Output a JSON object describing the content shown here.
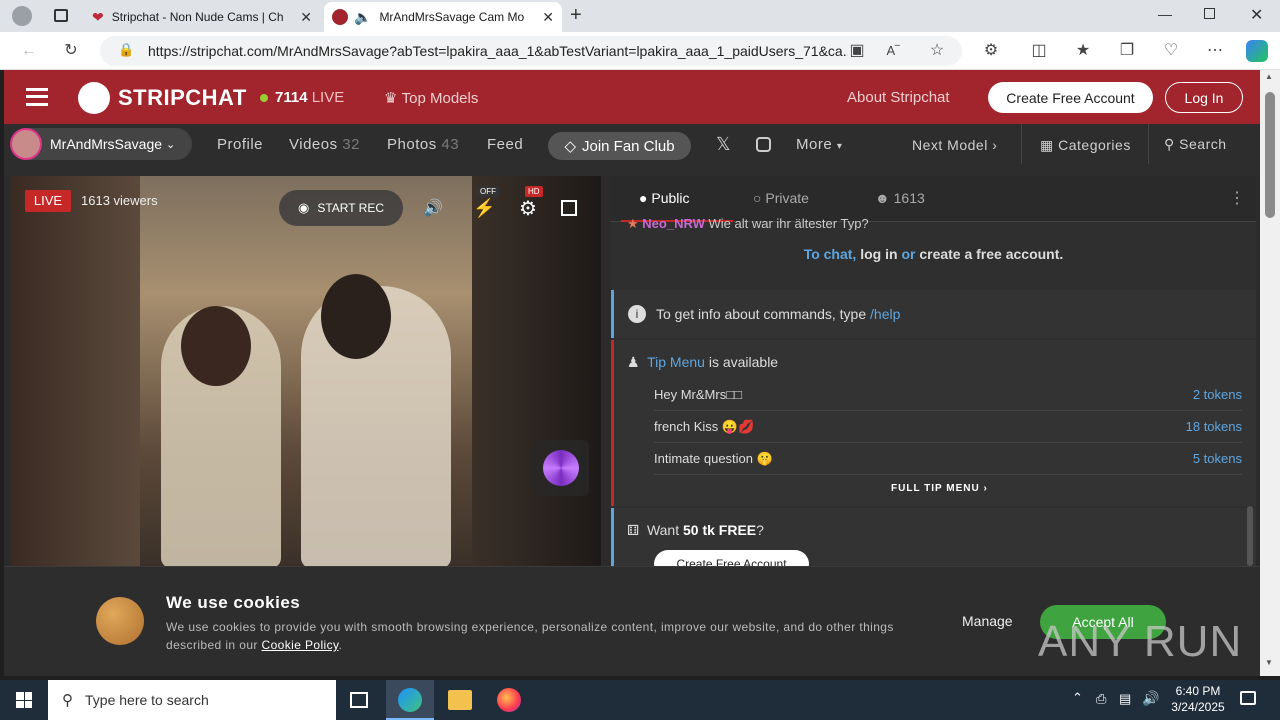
{
  "browser": {
    "tabs": [
      {
        "title": "Stripchat - Non Nude Cams | Ch",
        "active": false
      },
      {
        "title": "MrAndMrsSavage Cam Mo",
        "active": true
      }
    ],
    "url": "https://stripchat.com/MrAndMrsSavage?abTest=lpakira_aaa_1&abTestVariant=lpakira_aaa_1_paidUsers_71&ca..."
  },
  "header": {
    "logo_text": "STRIPCHAT",
    "live_count": "7114",
    "live_label": "LIVE",
    "top_models": "Top Models",
    "about": "About Stripchat",
    "create_account": "Create Free Account",
    "login": "Log In"
  },
  "subnav": {
    "model_name": "MrAndMrsSavage",
    "profile": "Profile",
    "videos": "Videos",
    "videos_count": "32",
    "photos": "Photos",
    "photos_count": "43",
    "feed": "Feed",
    "fan_club": "Join Fan Club",
    "more": "More",
    "next_model": "Next Model",
    "categories": "Categories",
    "search": "Search"
  },
  "video": {
    "live_badge": "LIVE",
    "viewers": "1613 viewers",
    "start_rec": "START REC",
    "off_badge": "OFF",
    "hd_badge": "HD"
  },
  "chat": {
    "tab_public": "Public",
    "tab_private": "Private",
    "user_count": "1613",
    "partial_user": "Neo_NRW",
    "partial_msg": "Wie alt war ihr ältester Typ?",
    "login_prompt_1": "To chat,",
    "login_prompt_2": "log in",
    "login_prompt_3": "or",
    "login_prompt_4": "create a free account.",
    "help_text": "To get info about commands, type",
    "help_cmd": "/help",
    "tip_menu_link": "Tip Menu",
    "tip_menu_avail": "is available",
    "tip_items": [
      {
        "name": "Hey Mr&Mrs□□",
        "tokens": "2 tokens"
      },
      {
        "name": "french Kiss 😛💋",
        "tokens": "18 tokens"
      },
      {
        "name": "Intimate question 🤫",
        "tokens": "5 tokens"
      }
    ],
    "full_tip_menu": "FULL TIP MENU",
    "want_1": "Want",
    "want_2": "50 tk FREE",
    "want_3": "?",
    "create_free": "Create Free Account"
  },
  "cookie": {
    "title": "We use cookies",
    "body": "We use cookies to provide you with smooth browsing experience, personalize content, improve our website, and do other things described in our",
    "policy_link": "Cookie Policy",
    "manage": "Manage",
    "accept": "Accept All"
  },
  "taskbar": {
    "search_placeholder": "Type here to search",
    "time": "6:40 PM",
    "date": "3/24/2025"
  },
  "watermark": "ANY RUN",
  "colors": {
    "brand_red": "#a2252d",
    "link_blue": "#5ea6e0",
    "accept_green": "#3fa33f"
  }
}
